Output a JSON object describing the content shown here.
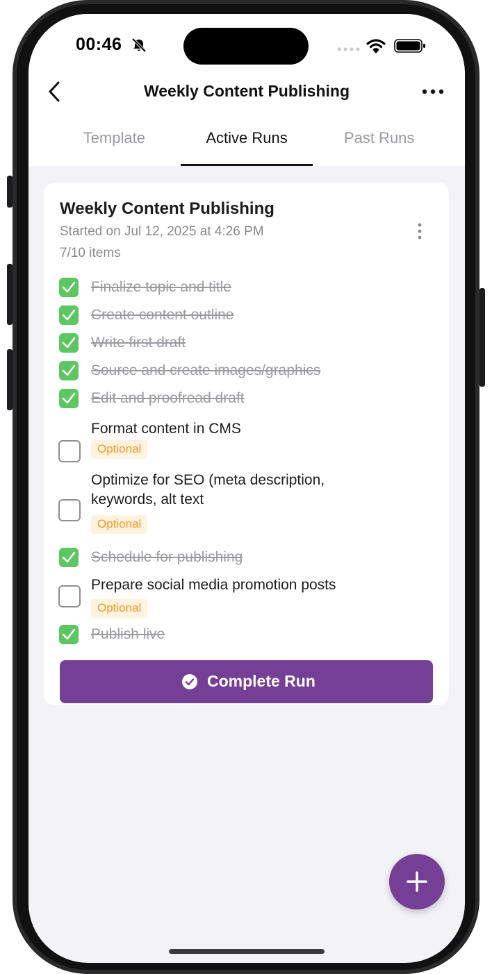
{
  "status_bar": {
    "time": "00:46"
  },
  "nav": {
    "title": "Weekly Content Publishing"
  },
  "tabs": [
    {
      "label": "Template",
      "active": false
    },
    {
      "label": "Active Runs",
      "active": true
    },
    {
      "label": "Past Runs",
      "active": false
    }
  ],
  "run": {
    "title": "Weekly Content Publishing",
    "started": "Started on Jul 12, 2025 at 4:26 PM",
    "count": "7/10 items",
    "items": [
      {
        "label": "Finalize topic and title",
        "checked": true
      },
      {
        "label": "Create content outline",
        "checked": true
      },
      {
        "label": "Write first draft",
        "checked": true
      },
      {
        "label": "Source and create images/graphics",
        "checked": true
      },
      {
        "label": "Edit and proofread draft",
        "checked": true
      },
      {
        "label": "Format content in CMS",
        "checked": false,
        "badge": "Optional"
      },
      {
        "label_line1": "Optimize for SEO (meta description,",
        "label_line2": "keywords, alt text",
        "checked": false,
        "badge": "Optional"
      },
      {
        "label": "Schedule for publishing",
        "checked": true
      },
      {
        "label": "Prepare social media promotion posts",
        "checked": false,
        "badge": "Optional"
      },
      {
        "label": "Publish live",
        "checked": true
      }
    ],
    "complete_label": "Complete Run"
  },
  "colors": {
    "accent": "#743f95",
    "check": "#5cc661",
    "badge_bg": "#fff2de",
    "badge_text": "#f39a26"
  }
}
